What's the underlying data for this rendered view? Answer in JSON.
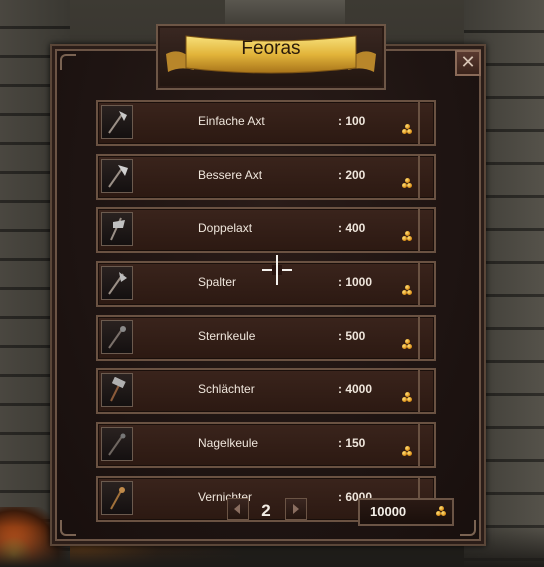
{
  "shop": {
    "title": "Feoras",
    "close_label": "✕",
    "items": [
      {
        "name": "Einfache Axt",
        "price": ": 100",
        "icon": "axe-icon"
      },
      {
        "name": "Bessere Axt",
        "price": ": 200",
        "icon": "axe-icon"
      },
      {
        "name": "Doppelaxt",
        "price": ": 400",
        "icon": "double-axe-icon"
      },
      {
        "name": "Spalter",
        "price": ": 1000",
        "icon": "axe-icon"
      },
      {
        "name": "Sternkeule",
        "price": ": 500",
        "icon": "mace-icon"
      },
      {
        "name": "Schlächter",
        "price": ": 4000",
        "icon": "hammer-icon"
      },
      {
        "name": "Nagelkeule",
        "price": ": 150",
        "icon": "mace-icon"
      },
      {
        "name": "Vernichter",
        "price": ": 6000",
        "icon": "flail-icon"
      }
    ],
    "page": "2",
    "gold": "10000"
  }
}
